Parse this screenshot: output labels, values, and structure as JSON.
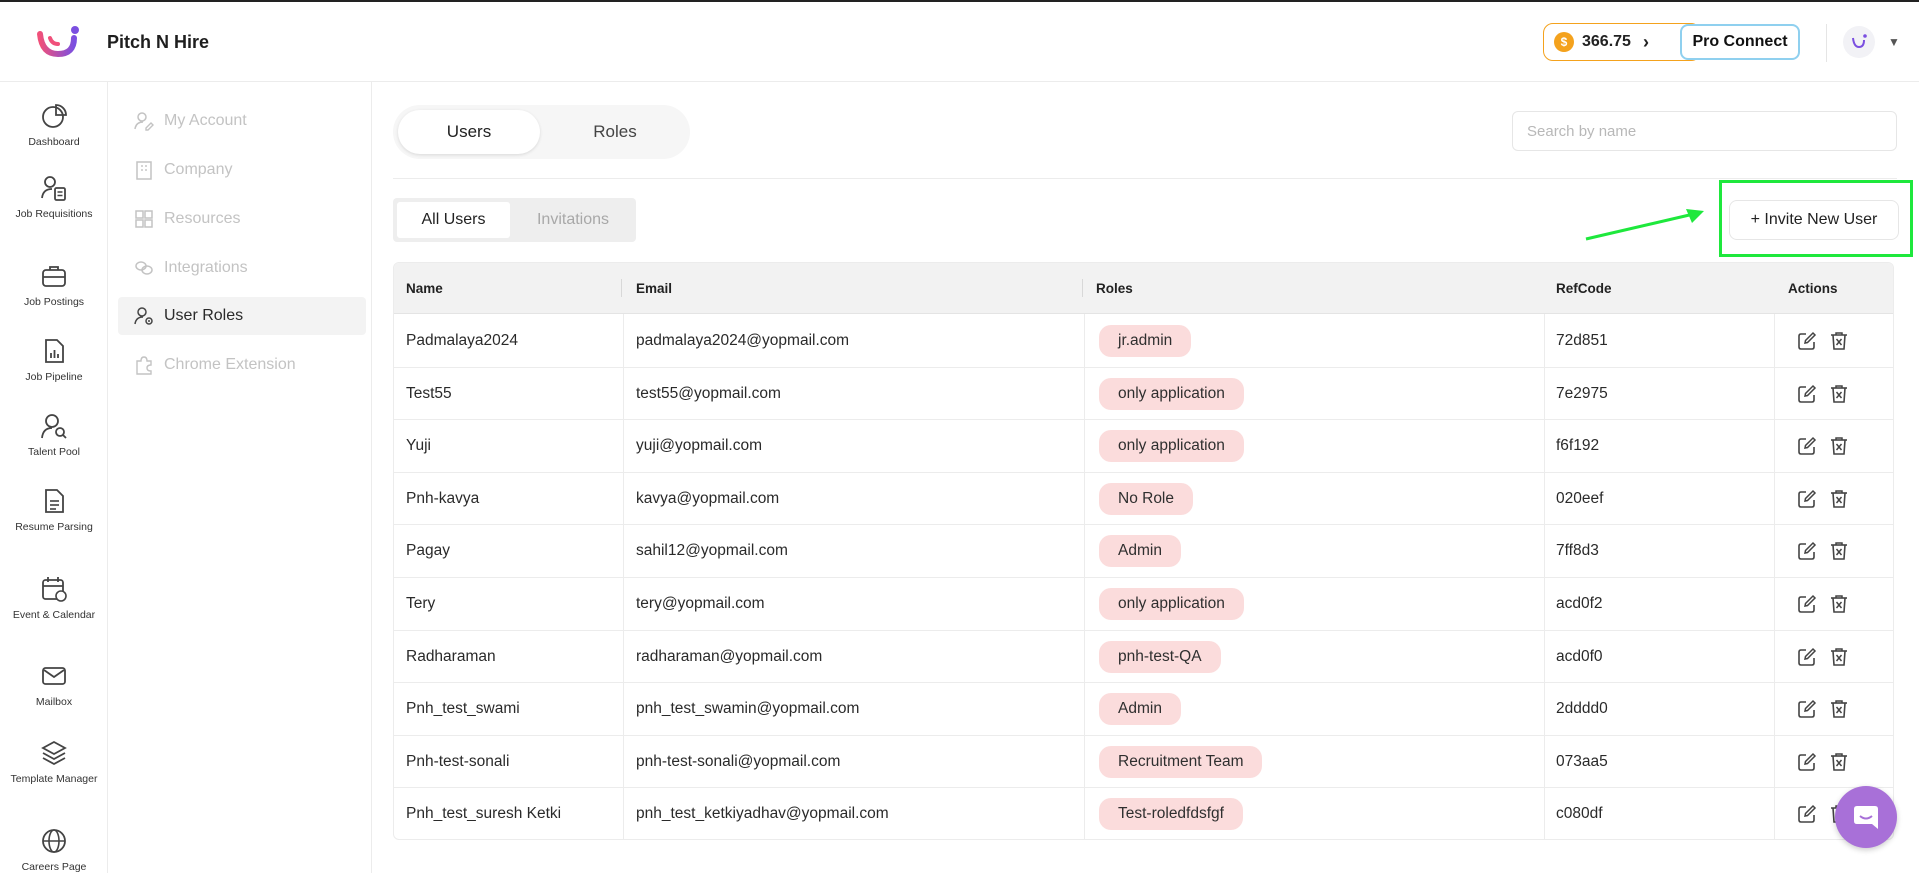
{
  "app": {
    "title": "Pitch N Hire"
  },
  "header": {
    "coins": "366.75",
    "pro_connect": "Pro Connect"
  },
  "rail": {
    "items": [
      {
        "label": "Dashboard",
        "icon": "pie-chart-icon"
      },
      {
        "label": "Job Requisitions",
        "icon": "user-document-icon"
      },
      {
        "label": "Job Postings",
        "icon": "briefcase-icon"
      },
      {
        "label": "Job Pipeline",
        "icon": "document-chart-icon"
      },
      {
        "label": "Talent Pool",
        "icon": "person-search-icon"
      },
      {
        "label": "Resume Parsing",
        "icon": "resume-icon"
      },
      {
        "label": "Event & Calendar",
        "icon": "calendar-icon"
      },
      {
        "label": "Mailbox",
        "icon": "mail-icon"
      },
      {
        "label": "Template Manager",
        "icon": "layers-icon"
      },
      {
        "label": "Careers Page",
        "icon": "globe-icon"
      }
    ]
  },
  "settings_nav": {
    "items": [
      {
        "label": "My Account",
        "icon": "user-edit-icon"
      },
      {
        "label": "Company",
        "icon": "building-icon"
      },
      {
        "label": "Resources",
        "icon": "grid-icon"
      },
      {
        "label": "Integrations",
        "icon": "link-icon"
      },
      {
        "label": "User Roles",
        "icon": "user-settings-icon"
      },
      {
        "label": "Chrome Extension",
        "icon": "puzzle-icon"
      }
    ]
  },
  "tabs": {
    "users": "Users",
    "roles": "Roles"
  },
  "search": {
    "placeholder": "Search by name"
  },
  "sub_tabs": {
    "all_users": "All Users",
    "invitations": "Invitations"
  },
  "invite_button": "+ Invite New User",
  "table": {
    "headers": {
      "name": "Name",
      "email": "Email",
      "roles": "Roles",
      "refcode": "RefCode",
      "actions": "Actions"
    },
    "rows": [
      {
        "name": "Padmalaya2024",
        "email": "padmalaya2024@yopmail.com",
        "role": "jr.admin",
        "refcode": "72d851"
      },
      {
        "name": "Test55",
        "email": "test55@yopmail.com",
        "role": "only application",
        "refcode": "7e2975"
      },
      {
        "name": "Yuji",
        "email": "yuji@yopmail.com",
        "role": "only application",
        "refcode": "f6f192"
      },
      {
        "name": "Pnh-kavya",
        "email": "kavya@yopmail.com",
        "role": "No Role",
        "refcode": "020eef"
      },
      {
        "name": "Pagay",
        "email": "sahil12@yopmail.com",
        "role": "Admin",
        "refcode": "7ff8d3"
      },
      {
        "name": "Tery",
        "email": "tery@yopmail.com",
        "role": "only application",
        "refcode": "acd0f2"
      },
      {
        "name": "Radharaman",
        "email": "radharaman@yopmail.com",
        "role": "pnh-test-QA",
        "refcode": "acd0f0"
      },
      {
        "name": "Pnh_test_swami",
        "email": "pnh_test_swamin@yopmail.com",
        "role": "Admin",
        "refcode": "2dddd0"
      },
      {
        "name": "Pnh-test-sonali",
        "email": "pnh-test-sonali@yopmail.com",
        "role": "Recruitment Team",
        "refcode": "073aa5"
      },
      {
        "name": "Pnh_test_suresh Ketki",
        "email": "pnh_test_ketkiyadhav@yopmail.com",
        "role": "Test-roledfdsfgf",
        "refcode": "c080df"
      }
    ]
  },
  "colors": {
    "accent_highlight": "#1ee83c",
    "badge_bg": "#fbdcdc",
    "chat_bubble": "#a870d8",
    "coin": "#f4a21d"
  }
}
